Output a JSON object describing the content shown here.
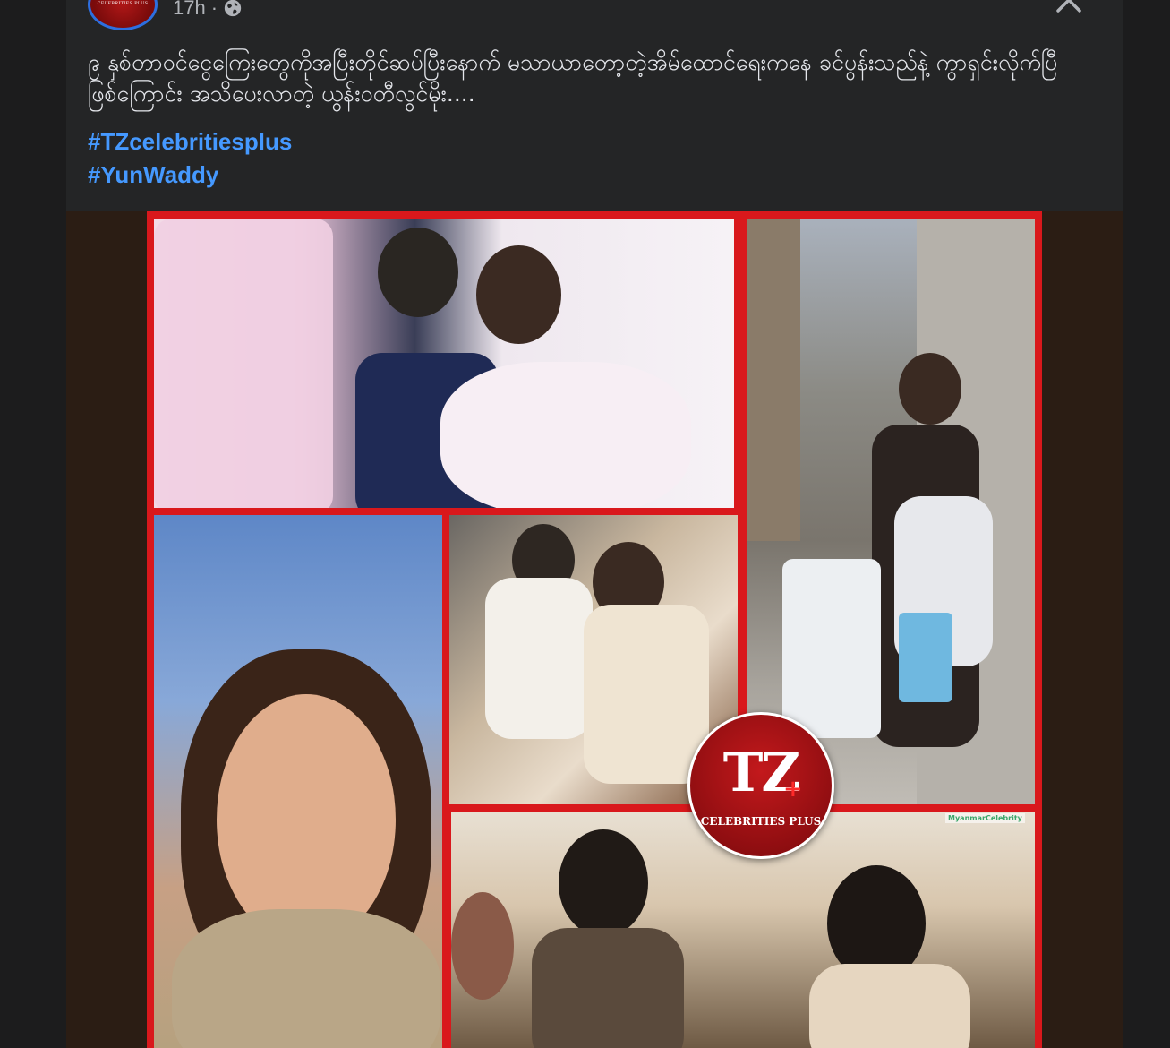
{
  "post": {
    "time": "17h",
    "separator": "·",
    "avatar_text": "CELEBRITIES PLUS",
    "caption": "၉ နှစ်တာဝင်ငွေကြေးတွေကိုအပြီးတိုင်ဆပ်ပြီးနောက် မသာယာတော့တဲ့အိမ်ထောင်ရေးကနေ ခင်ပွန်းသည်နဲ့ ကွာရှင်းလိုက်ပြီဖြစ်ကြောင်း အသိပေးလာတဲ့ ယွန်းဝတီလွင်မိုး....",
    "hashtags": [
      "#TZcelebritiesplus",
      "#YunWaddy"
    ]
  },
  "media": {
    "logo_main": "TZ",
    "logo_plus": "+",
    "logo_sub": "CELEBRITIES PLUS",
    "watermark": "MyanmarCelebrity"
  },
  "colors": {
    "background": "#1c1c1d",
    "card": "#242526",
    "hashtag": "#4599ff",
    "collage_frame": "#d9181c"
  },
  "icons": [
    "globe-icon",
    "close-icon"
  ]
}
